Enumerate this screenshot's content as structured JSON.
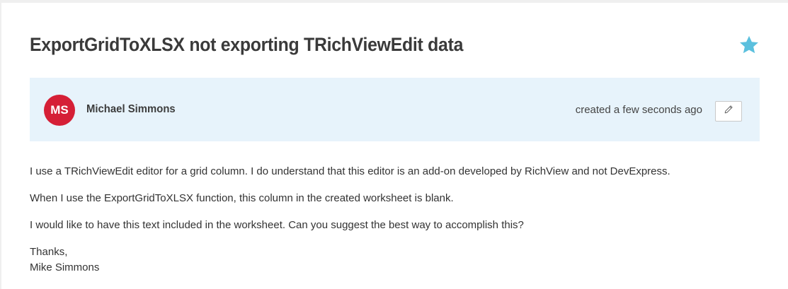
{
  "ticket": {
    "title": "ExportGridToXLSX not exporting TRichViewEdit data"
  },
  "author": {
    "initials": "MS",
    "name": "Michael Simmons",
    "avatar_color": "#d51f36",
    "created": "created a few seconds ago"
  },
  "icons": {
    "favorite": "star-icon",
    "edit": "pencil-icon"
  },
  "colors": {
    "star": "#5bc0de",
    "author_bg": "#e7f3fb"
  },
  "body": {
    "paragraphs": [
      "I use a TRichViewEdit editor for a grid column. I do understand that this editor is an add-on developed by RichView and not DevExpress.",
      "When I use the ExportGridToXLSX function, this column in the created worksheet is blank.",
      "I would like to have this text included in the worksheet. Can you suggest the best way to accomplish this?"
    ],
    "closing": "Thanks,",
    "signature": "Mike Simmons"
  }
}
